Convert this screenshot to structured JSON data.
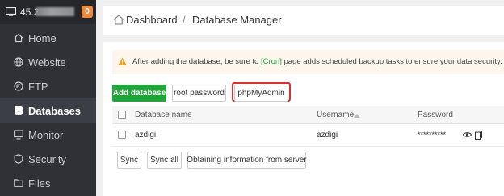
{
  "sidebar": {
    "server": {
      "ip_prefix": "45.2",
      "badge": "0"
    },
    "items": [
      {
        "label": "Home",
        "icon": "home-icon",
        "active": false
      },
      {
        "label": "Website",
        "icon": "globe-icon",
        "active": false
      },
      {
        "label": "FTP",
        "icon": "ftp-icon",
        "active": false
      },
      {
        "label": "Databases",
        "icon": "database-icon",
        "active": true
      },
      {
        "label": "Monitor",
        "icon": "monitor-icon",
        "active": false
      },
      {
        "label": "Security",
        "icon": "shield-icon",
        "active": false
      },
      {
        "label": "Files",
        "icon": "folder-icon",
        "active": false
      }
    ]
  },
  "breadcrumb": {
    "home": "Dashboard",
    "separator": "/",
    "current": "Database Manager"
  },
  "notice": {
    "text_before": "After adding the database, be sure to ",
    "link": "[Cron]",
    "text_after": " page adds scheduled backup tasks to ensure your data security."
  },
  "toolbar": {
    "add_database": "Add database",
    "root_password": "root password",
    "phpmyadmin": "phpMyAdmin"
  },
  "table": {
    "headers": {
      "name": "Database name",
      "username": "Username",
      "password": "Password"
    },
    "rows": [
      {
        "name": "azdigi",
        "username": "azdigi",
        "password": "**********"
      }
    ]
  },
  "actions": {
    "sync": "Sync",
    "sync_all": "Sync all",
    "obtain": "Obtaining information from server"
  },
  "colors": {
    "accent": "#20a53a",
    "highlight": "#d9312e",
    "sidebar": "#2f3136",
    "badge": "#f0883a"
  }
}
